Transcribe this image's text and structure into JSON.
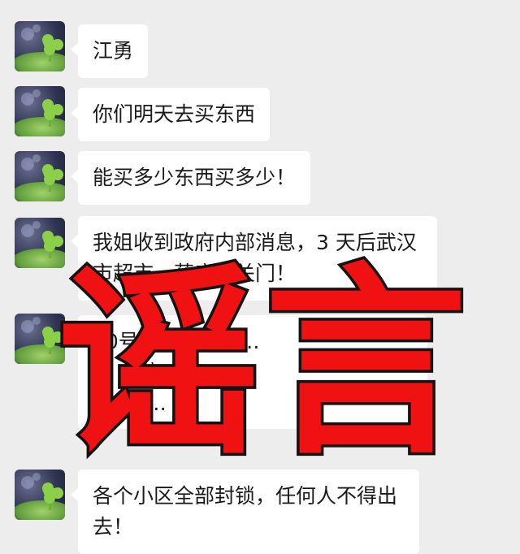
{
  "messages": [
    {
      "text": "江勇"
    },
    {
      "text": "你们明天去买东西"
    },
    {
      "text": "能买多少东西买多少！"
    },
    {
      "line1": "我姐收到政府内部消息，3 天后武汉",
      "line2": "市超市、药店、关门！"
    },
    {
      "line1": "10号 … 政军接 …",
      "line2": "… 单位 …",
      "line3": "… 回 …"
    },
    {
      "line1": "各个小区全部封锁，任何人不得出",
      "line2": "去！"
    }
  ],
  "stamp": {
    "char1": "谣",
    "char2": "言",
    "color": "#f01212"
  },
  "avatar": {
    "icon": "clover-icon"
  }
}
